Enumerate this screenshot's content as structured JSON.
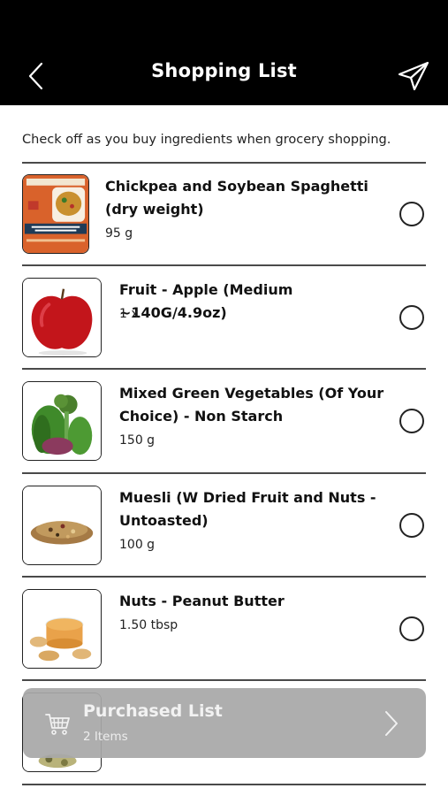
{
  "header": {
    "title": "Shopping List",
    "back_icon": "chevron-left-icon",
    "send_icon": "paper-plane-icon"
  },
  "instructions": "Check off as you buy ingredients when grocery shopping.",
  "items": [
    {
      "name": "Chickpea and Soybean Spaghetti (dry weight)",
      "qty": "95 g",
      "checked": false
    },
    {
      "name": "Fruit - Apple (Medium ~140G/4.9oz)",
      "qty": "1 x",
      "checked": false
    },
    {
      "name": "Mixed Green Vegetables (Of Your Choice) - Non Starch",
      "qty": "150 g",
      "checked": false
    },
    {
      "name": "Muesli (W Dried Fruit and Nuts - Untoasted)",
      "qty": "100 g",
      "checked": false
    },
    {
      "name": "Nuts - Peanut Butter",
      "qty": "1.50 tbsp",
      "checked": false
    }
  ],
  "purchased": {
    "title": "Purchased List",
    "count": "2 Items",
    "cart_icon": "cart-icon",
    "chevron_icon": "chevron-right-icon"
  }
}
